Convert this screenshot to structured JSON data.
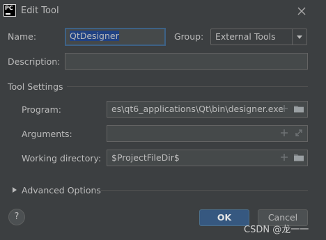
{
  "window": {
    "title": "Edit Tool",
    "app_icon": "pycharm-icon",
    "close_icon": "close-icon"
  },
  "form": {
    "name_label": "Name:",
    "name_value": "QtDesigner",
    "group_label": "Group:",
    "group_value": "External Tools",
    "description_label": "Description:",
    "description_value": ""
  },
  "tool_settings": {
    "section_title": "Tool Settings",
    "program_label": "Program:",
    "program_value": "es\\qt6_applications\\Qt\\bin\\designer.exe",
    "arguments_label": "Arguments:",
    "arguments_value": "",
    "working_dir_label": "Working directory:",
    "working_dir_value": "$ProjectFileDir$"
  },
  "advanced": {
    "label": "Advanced Options"
  },
  "buttons": {
    "help": "?",
    "ok": "OK",
    "cancel": "Cancel"
  },
  "watermark": "CSDN @龙一一",
  "colors": {
    "background": "#3c3f41",
    "field": "#45494a",
    "focus_border": "#3d6185",
    "ok_button": "#365880",
    "text": "#bbbbbb"
  }
}
